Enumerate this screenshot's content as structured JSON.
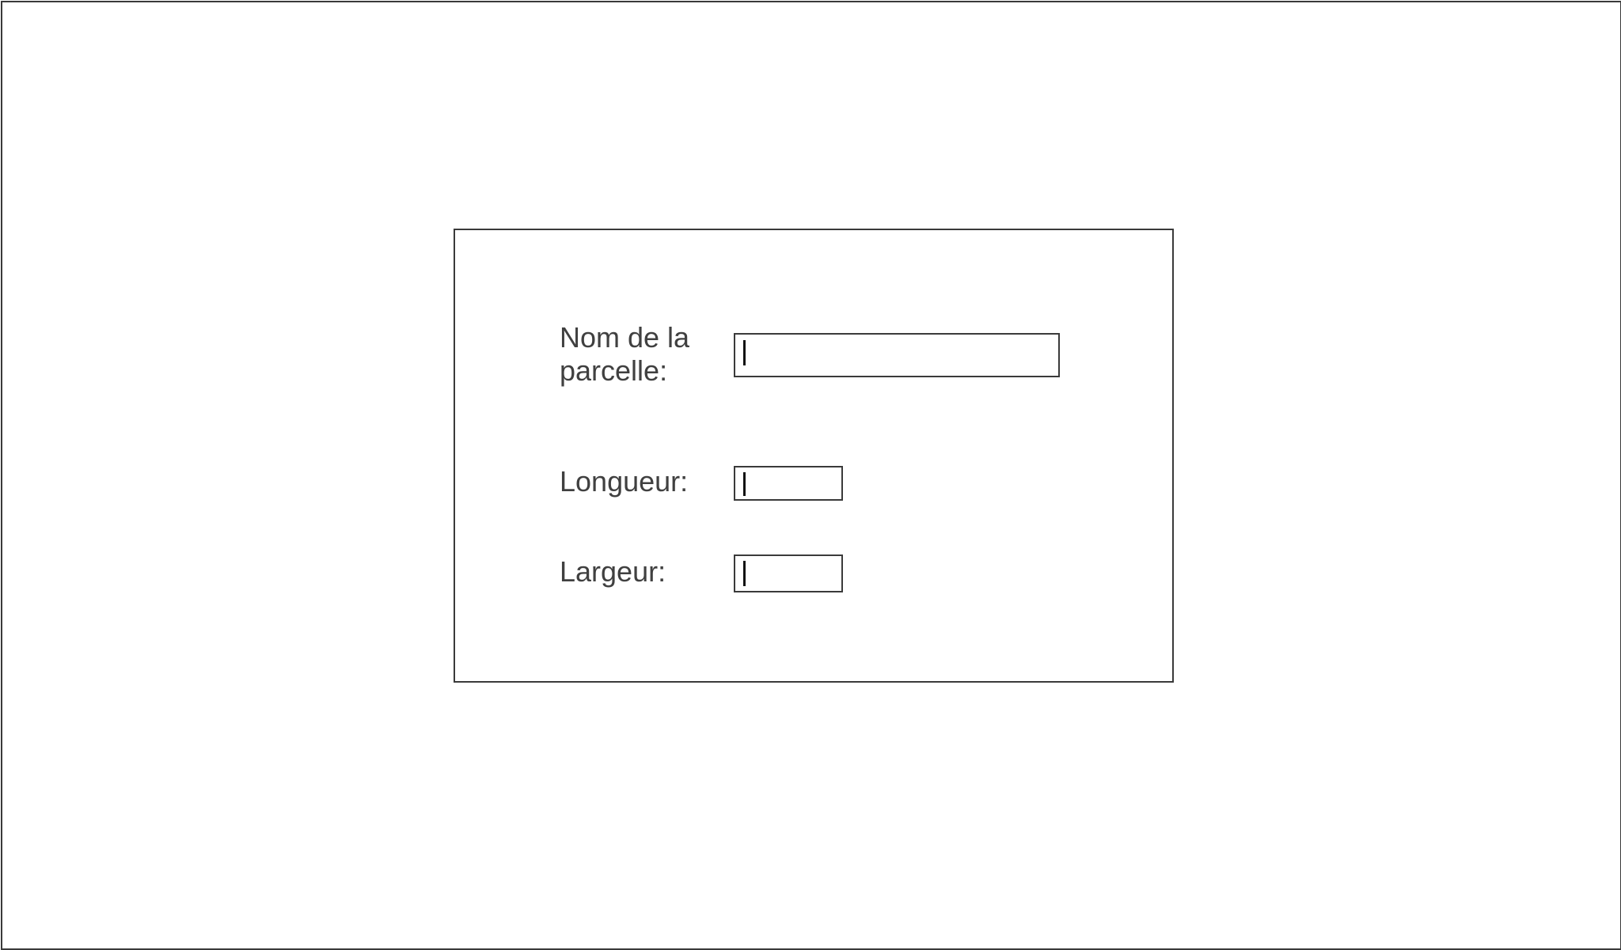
{
  "form": {
    "fields": [
      {
        "label": "Nom de la\nparcelle:",
        "value": ""
      },
      {
        "label": "Longueur:",
        "value": ""
      },
      {
        "label": "Largeur:",
        "value": ""
      }
    ]
  }
}
